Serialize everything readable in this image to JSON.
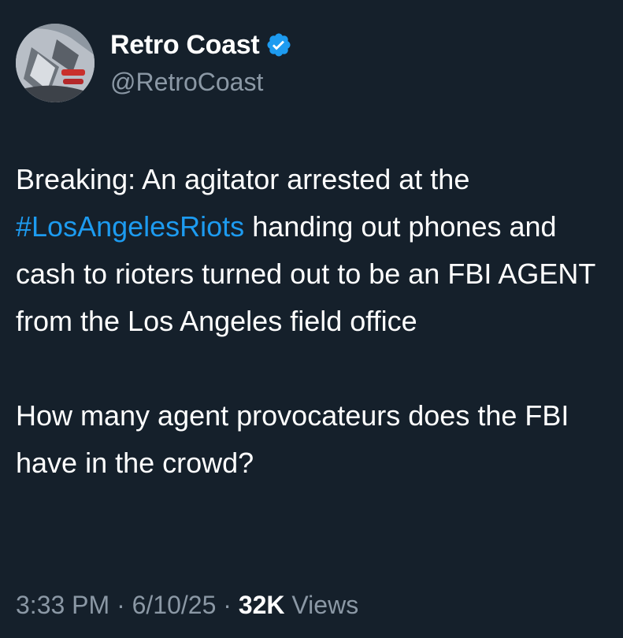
{
  "colors": {
    "background": "#15202b",
    "text": "#ffffff",
    "secondary_text": "#8b98a5",
    "link": "#1d9bf0",
    "verified_badge": "#1d9bf0"
  },
  "author": {
    "display_name": "Retro Coast",
    "handle": "@RetroCoast",
    "verified": true,
    "avatar_icon": "vintage-car-taillight-avatar",
    "badge_icon": "verified-badge-icon"
  },
  "tweet": {
    "para1_before": "Breaking: An agitator arrested at the ",
    "hashtag": "#LosAngelesRiots",
    "para1_after": " handing out phones and cash to rioters turned out to be an FBI AGENT from the Los Angeles field office",
    "para2": "How many agent provocateurs does the FBI have in the crowd?"
  },
  "meta": {
    "time": "3:33 PM",
    "separator": "·",
    "date": "6/10/25",
    "views_count": "32K",
    "views_label": "Views"
  }
}
